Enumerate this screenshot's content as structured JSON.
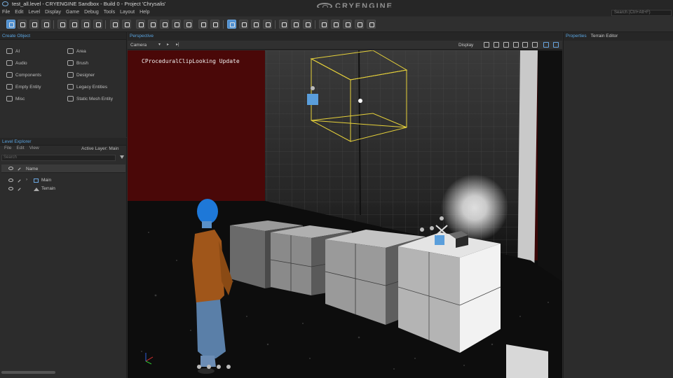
{
  "window": {
    "title": "test_all.level - CRYENGINE Sandbox - Build 0 - Project 'Chrysalis'",
    "brand": "CRYENGINE",
    "search_placeholder": "Search (Ctrl+Alt+F)"
  },
  "menu": [
    "File",
    "Edit",
    "Level",
    "Display",
    "Game",
    "Debug",
    "Tools",
    "Layout",
    "Help"
  ],
  "create_object": {
    "title": "Create Object",
    "items": [
      "AI",
      "Audio",
      "Components",
      "Empty Entity",
      "Misc",
      "Area",
      "Brush",
      "Designer",
      "Legacy Entities",
      "Static Mesh Entity"
    ]
  },
  "level_explorer": {
    "title": "Level Explorer",
    "menu": [
      "File",
      "Edit",
      "View"
    ],
    "active_layer": "Active Layer: Main",
    "search_placeholder": "Search",
    "column_name": "Name",
    "rows": [
      "Main",
      "Terrain"
    ]
  },
  "viewport": {
    "title": "Perspective",
    "camera_label": "Camera",
    "display_label": "Display",
    "debug_text": "CProceduralClipLooking Update"
  },
  "right_panel": {
    "tabs": [
      "Properties",
      "Terrain Editor"
    ]
  },
  "icons": {
    "toolbar": [
      "select-icon",
      "move-icon",
      "rotate-icon",
      "scale-icon",
      "snap-grid-icon",
      "snap-angle-icon",
      "snap-scale-icon",
      "snap-terrain-icon",
      "vertex-snap-icon",
      "search-icon",
      "reference-icon",
      "group-icon",
      "link-icon",
      "unlink-icon",
      "physics-icon",
      "ruler-icon",
      "pick-icon",
      "play-icon",
      "camera-icon",
      "record-icon",
      "ai-icon",
      "mute-icon",
      "volume-icon",
      "vr-icon",
      "terrain-icon",
      "character-icon",
      "path-icon",
      "landscape-icon",
      "tree-icon"
    ]
  },
  "colors": {
    "accent": "#5aa4e0",
    "selection_box": "#e6d13a",
    "background_wall": "#5a0a0a"
  }
}
